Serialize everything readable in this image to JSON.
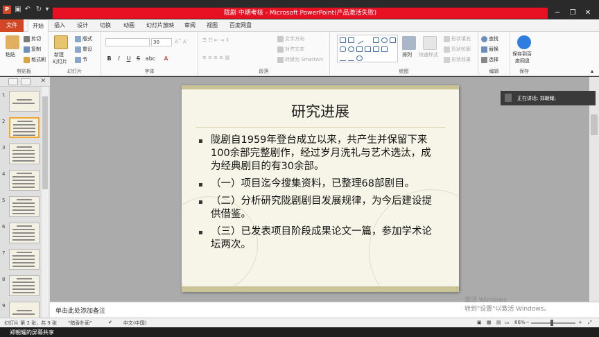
{
  "window": {
    "title": "陇剧 中期考核 - Microsoft PowerPoint(产品激活失败)",
    "app_icon": "P"
  },
  "ribbon_tabs": [
    "文件",
    "开始",
    "插入",
    "设计",
    "切换",
    "动画",
    "幻灯片放映",
    "审阅",
    "视图",
    "百度网盘"
  ],
  "ribbon": {
    "clipboard": {
      "paste": "粘贴",
      "cut": "剪切",
      "copy": "复制",
      "format_painter": "格式刷",
      "label": "剪贴板"
    },
    "slides": {
      "new_slide": "新建",
      "new_slide2": "幻灯片",
      "layout": "版式",
      "reset": "重设",
      "section": "节",
      "label": "幻灯片"
    },
    "font": {
      "size": "30",
      "label": "字体",
      "bold": "B",
      "italic": "I",
      "underline": "U",
      "strike": "S",
      "shadow": "abc"
    },
    "paragraph": {
      "text_direction": "文字方向",
      "align_text": "对齐文本",
      "smartart": "转换为 SmartArt",
      "label": "段落"
    },
    "drawing": {
      "arrange": "排列",
      "quick_styles": "快速样式",
      "shape_fill": "形状填充",
      "shape_outline": "形状轮廓",
      "shape_effects": "形状效果",
      "label": "绘图"
    },
    "editing": {
      "find": "查找",
      "replace": "替换",
      "select": "选择",
      "label": "编辑"
    },
    "save": {
      "save_to": "保存到百",
      "save_to2": "度网盘",
      "label": "保存"
    }
  },
  "slide": {
    "title": "研究进展",
    "bullets": [
      "陇剧自1959年登台成立以来，共产生并保留下来100余部完整剧作，经过岁月洗礼与艺术选汰，成为经典剧目的有30余部。",
      "（一）项目迄今搜集资料，已整理68部剧目。",
      "（二）分析研究陇剧剧目发展规律，为今后建设提供借鉴。",
      "（三）已发表项目阶段成果论文一篇，参加学术论坛两次。"
    ],
    "bullet_glyph": "▪"
  },
  "thumbnails": {
    "numbers": [
      "1",
      "2",
      "3",
      "4",
      "5",
      "6",
      "7",
      "8",
      "9"
    ],
    "selected": "2"
  },
  "notes": {
    "placeholder": "单击此处添加备注"
  },
  "speaker": {
    "text": "正在讲话: 郑朝耀;"
  },
  "watermark": {
    "line1": "激活 Windows",
    "line2": "转到\"设置\"以激活 Windows。"
  },
  "status": {
    "slide_info": "幻灯片 第 2 张，共 9 张",
    "theme": "\"暗香扑面\"",
    "language": "中文(中国)",
    "zoom": "66%"
  },
  "share": {
    "text": "郑朝耀的屏幕共享"
  },
  "colors": {
    "accent": "#d24726",
    "title_bar_red": "#e81123",
    "selection": "#f0a830"
  }
}
